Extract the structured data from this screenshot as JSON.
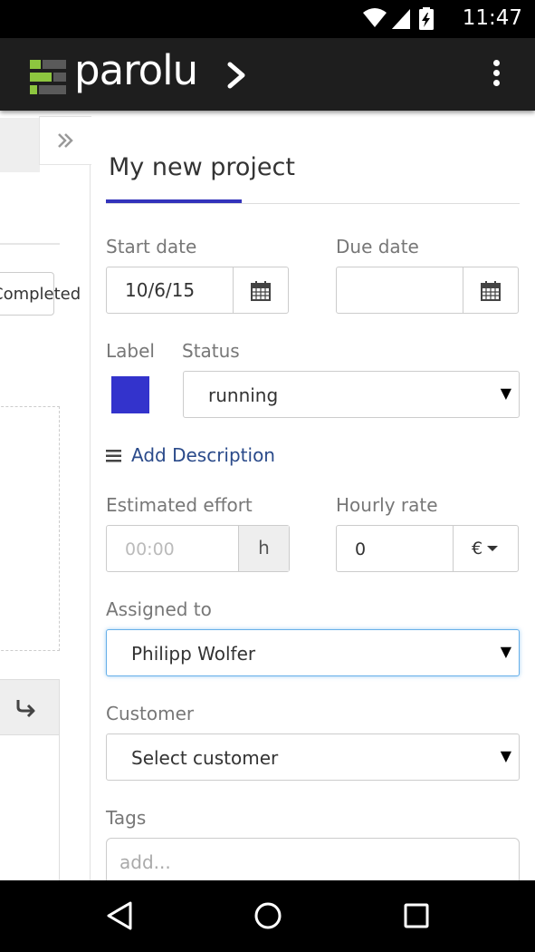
{
  "status_bar": {
    "time": "11:47",
    "icons": [
      "wifi-icon",
      "signal-icon",
      "battery-charging-icon"
    ]
  },
  "app_bar": {
    "brand": "parolu",
    "icons": [
      "parolu-logo-icon",
      "chevron-right-icon",
      "overflow-menu-icon"
    ]
  },
  "left_panel": {
    "completed_label": "Completed",
    "icons": [
      "expand-double-chevron-icon",
      "reply-arrow-icon"
    ]
  },
  "project": {
    "title": "My new project",
    "start_date_label": "Start date",
    "start_date_value": "10/6/15",
    "due_date_label": "Due date",
    "due_date_value": "",
    "label_label": "Label",
    "label_color": "#3333cc",
    "status_label": "Status",
    "status_value": "running",
    "add_description": "Add Description",
    "estimated_effort_label": "Estimated effort",
    "estimated_effort_placeholder": "00:00",
    "estimated_effort_unit": "h",
    "hourly_rate_label": "Hourly rate",
    "hourly_rate_value": "0",
    "currency": "€",
    "assigned_to_label": "Assigned to",
    "assigned_to_value": "Philipp Wolfer",
    "customer_label": "Customer",
    "customer_value": "Select customer",
    "tags_label": "Tags",
    "tags_placeholder": "add..."
  },
  "nav_bar": {
    "icons": [
      "back-icon",
      "home-icon",
      "recents-icon"
    ]
  },
  "colors": {
    "accent": "#3333bb",
    "app_bar": "#1e1e1e",
    "link": "#2a4a8a",
    "focus": "#66afe9",
    "logo_green": "#8dc63f"
  }
}
